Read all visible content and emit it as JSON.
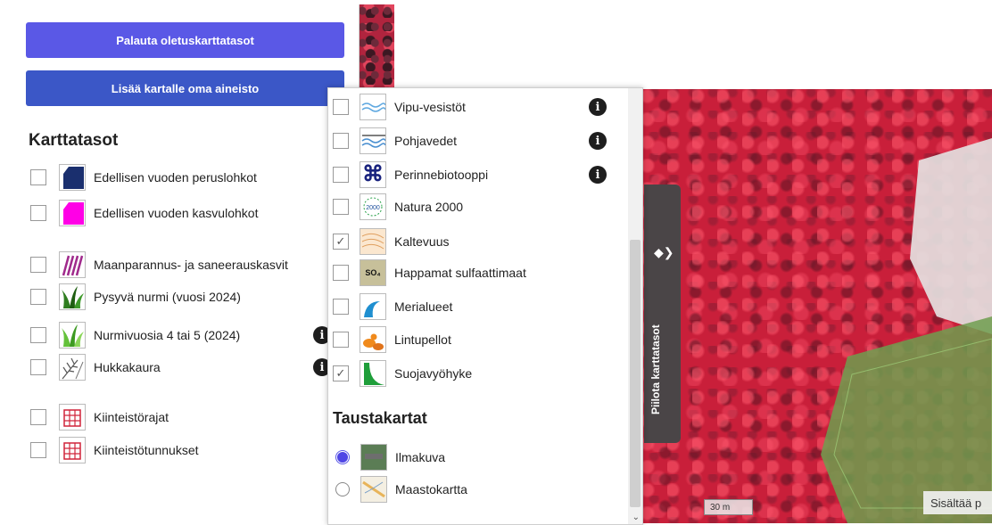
{
  "left_panel": {
    "reset_button": "Palauta oletuskarttatasot",
    "add_button": "Lisää kartalle oma aineisto",
    "heading": "Karttatasot",
    "layers": [
      {
        "label": "Edellisen vuoden peruslohkot",
        "icon": "dark-blue-parcel-icon",
        "checked": false
      },
      {
        "label": "Edellisen vuoden kasvulohkot",
        "icon": "magenta-parcel-icon",
        "checked": false
      },
      {
        "label": "Maanparannus- ja saneerauskasvit",
        "icon": "purple-stripes-icon",
        "checked": false
      },
      {
        "label": "Pysyvä nurmi (vuosi 2024)",
        "icon": "grass-icon",
        "checked": false
      },
      {
        "label": "Nurmivuosia 4 tai 5 (2024)",
        "icon": "grass-light-icon",
        "checked": false
      },
      {
        "label": "Hukkakaura",
        "icon": "wild-oat-icon",
        "checked": false
      },
      {
        "label": "Kiinteistörajat",
        "icon": "property-fence-icon",
        "checked": false
      },
      {
        "label": "Kiinteistötunnukset",
        "icon": "property-fence-icon",
        "checked": false
      }
    ]
  },
  "popup": {
    "layers": [
      {
        "label": "Vipu-vesistöt",
        "icon": "water-waves-icon",
        "checked": false,
        "info": true
      },
      {
        "label": "Pohjavedet",
        "icon": "groundwater-icon",
        "checked": false,
        "info": true
      },
      {
        "label": "Perinnebiotooppi",
        "icon": "heritage-biotope-icon",
        "checked": false,
        "info": true
      },
      {
        "label": "Natura 2000",
        "icon": "natura-2000-icon",
        "checked": false,
        "info": false
      },
      {
        "label": "Kaltevuus",
        "icon": "slope-contour-icon",
        "checked": true,
        "info": false
      },
      {
        "label": "Happamat sulfaattimaat",
        "icon": "sulfate-soil-icon",
        "checked": false,
        "info": false
      },
      {
        "label": "Merialueet",
        "icon": "sea-wave-icon",
        "checked": false,
        "info": false
      },
      {
        "label": "Lintupellot",
        "icon": "birds-icon",
        "checked": false,
        "info": false
      },
      {
        "label": "Suojavyöhyke",
        "icon": "buffer-zone-icon",
        "checked": true,
        "info": false
      }
    ],
    "background_heading": "Taustakartat",
    "background_maps": [
      {
        "label": "Ilmakuva",
        "icon": "aerial-thumbnail-icon",
        "selected": true
      },
      {
        "label": "Maastokartta",
        "icon": "terrain-map-thumbnail-icon",
        "selected": false
      }
    ],
    "sulfate_icon_text": "SO₄",
    "natura_icon_text": "2000"
  },
  "map": {
    "hide_panel_label": "Piilota karttatasot",
    "scale": "30 m",
    "attribution": "Sisältää p"
  },
  "colors": {
    "primary_button": "#5a58e6",
    "secondary_button": "#3b57c7",
    "map_red": "#c91f3a",
    "buffer_green": "#6f9e4f"
  }
}
